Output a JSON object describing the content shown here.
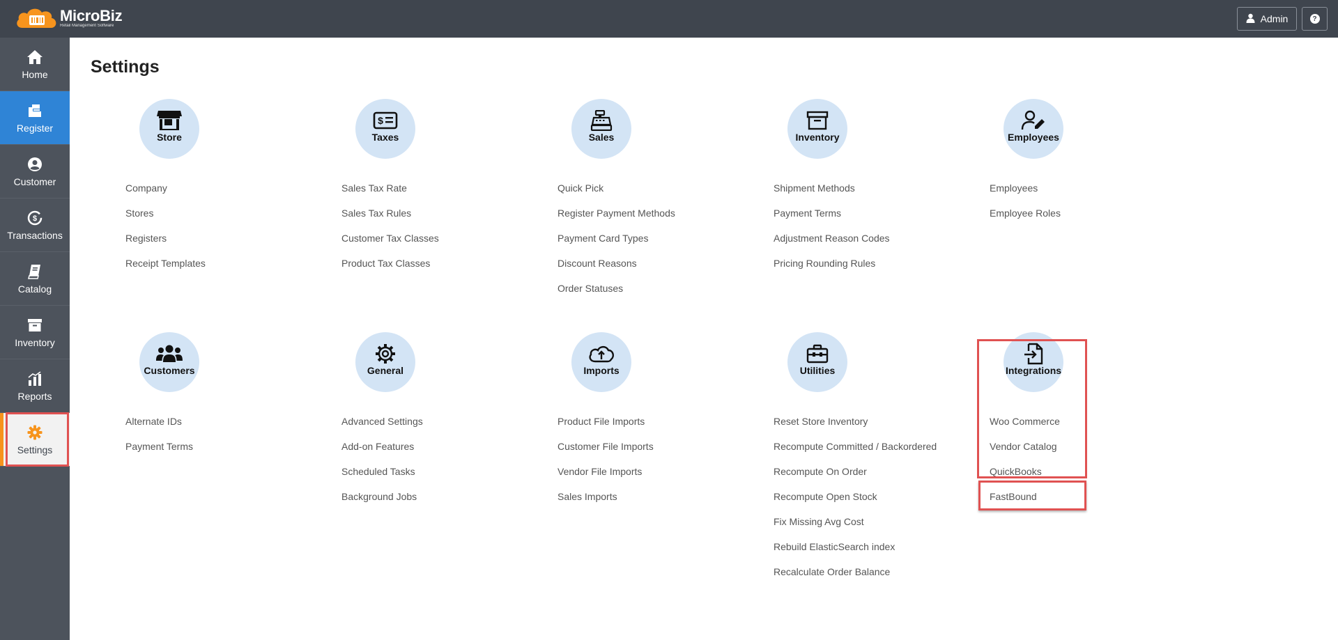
{
  "app": {
    "name": "MicroBiz",
    "tagline": "Retail Management Software",
    "brand_color": "#f7941d",
    "topbar_color": "#3f454e"
  },
  "header": {
    "admin_label": "Admin",
    "help_icon": "question-circle-icon"
  },
  "sidebar": {
    "items": [
      {
        "label": "Home",
        "icon": "home-icon"
      },
      {
        "label": "Register",
        "icon": "register-icon"
      },
      {
        "label": "Customer",
        "icon": "customer-icon"
      },
      {
        "label": "Transactions",
        "icon": "transactions-icon"
      },
      {
        "label": "Catalog",
        "icon": "catalog-icon"
      },
      {
        "label": "Inventory",
        "icon": "inventory-icon"
      },
      {
        "label": "Reports",
        "icon": "reports-icon"
      },
      {
        "label": "Settings",
        "icon": "gear-icon"
      }
    ],
    "active": "Settings"
  },
  "main": {
    "title": "Settings",
    "sections": [
      {
        "title": "Store",
        "icon": "store-icon",
        "links": [
          "Company",
          "Stores",
          "Registers",
          "Receipt Templates"
        ]
      },
      {
        "title": "Taxes",
        "icon": "taxes-icon",
        "links": [
          "Sales Tax Rate",
          "Sales Tax Rules",
          "Customer Tax Classes",
          "Product Tax Classes"
        ]
      },
      {
        "title": "Sales",
        "icon": "cash-register-icon",
        "links": [
          "Quick Pick",
          "Register Payment Methods",
          "Payment Card Types",
          "Discount Reasons",
          "Order Statuses"
        ]
      },
      {
        "title": "Inventory",
        "icon": "archive-box-icon",
        "links": [
          "Shipment Methods",
          "Payment Terms",
          "Adjustment Reason Codes",
          "Pricing Rounding Rules"
        ]
      },
      {
        "title": "Employees",
        "icon": "user-edit-icon",
        "links": [
          "Employees",
          "Employee Roles"
        ]
      },
      {
        "title": "Customers",
        "icon": "users-group-icon",
        "links": [
          "Alternate IDs",
          "Payment Terms"
        ]
      },
      {
        "title": "General",
        "icon": "gear-icon",
        "links": [
          "Advanced Settings",
          "Add-on Features",
          "Scheduled Tasks",
          "Background Jobs"
        ]
      },
      {
        "title": "Imports",
        "icon": "cloud-upload-icon",
        "links": [
          "Product File Imports",
          "Customer File Imports",
          "Vendor File Imports",
          "Sales Imports"
        ]
      },
      {
        "title": "Utilities",
        "icon": "toolbox-icon",
        "links": [
          "Reset Store Inventory",
          "Recompute Committed / Backordered",
          "Recompute On Order",
          "Recompute Open Stock",
          "Fix Missing Avg Cost",
          "Rebuild ElasticSearch index",
          "Recalculate Order Balance"
        ]
      },
      {
        "title": "Integrations",
        "icon": "file-import-icon",
        "links": [
          "Woo Commerce",
          "Vendor Catalog",
          "QuickBooks",
          "FastBound"
        ]
      }
    ]
  }
}
